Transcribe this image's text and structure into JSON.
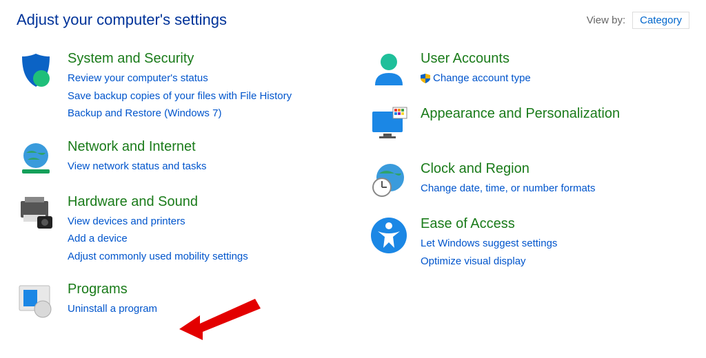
{
  "header": {
    "title": "Adjust your computer's settings",
    "viewby_label": "View by:",
    "viewby_value": "Category"
  },
  "left": [
    {
      "name": "System and Security",
      "links": [
        "Review your computer's status",
        "Save backup copies of your files with File History",
        "Backup and Restore (Windows 7)"
      ]
    },
    {
      "name": "Network and Internet",
      "links": [
        "View network status and tasks"
      ]
    },
    {
      "name": "Hardware and Sound",
      "links": [
        "View devices and printers",
        "Add a device",
        "Adjust commonly used mobility settings"
      ]
    },
    {
      "name": "Programs",
      "links": [
        "Uninstall a program"
      ]
    }
  ],
  "right": [
    {
      "name": "User Accounts",
      "links": [
        "Change account type"
      ],
      "shield0": true
    },
    {
      "name": "Appearance and Personalization",
      "links": []
    },
    {
      "name": "Clock and Region",
      "links": [
        "Change date, time, or number formats"
      ]
    },
    {
      "name": "Ease of Access",
      "links": [
        "Let Windows suggest settings",
        "Optimize visual display"
      ]
    }
  ]
}
